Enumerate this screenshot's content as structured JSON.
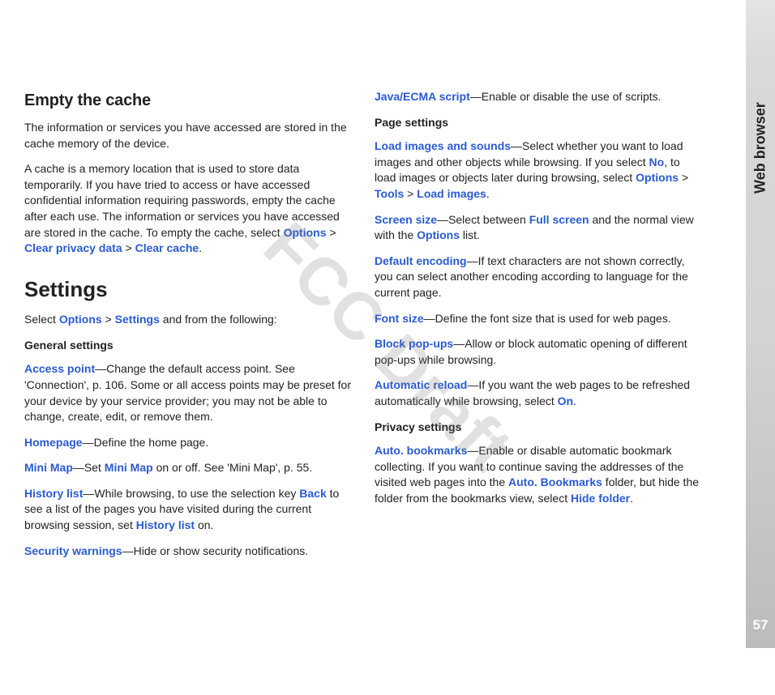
{
  "side": {
    "section": "Web browser",
    "pagenum": "57"
  },
  "watermark": "FCC Draft",
  "left": {
    "h_empty": "Empty the cache",
    "p1": "The information or services you have accessed are stored in the cache memory of the device.",
    "p2a": "A cache is a memory location that is used to store data temporarily. If you have tried to access or have accessed confidential information requiring passwords, empty the cache after each use. The information or services you have accessed are stored in the cache. To empty the cache, select ",
    "p2_opt": "Options",
    "p2_gt1": " > ",
    "p2_cpd": "Clear privacy data",
    "p2_gt2": " > ",
    "p2_cc": "Clear cache",
    "p2_end": ".",
    "h_settings": "Settings",
    "p3a": "Select ",
    "p3_opt": "Options",
    "p3_gt": " > ",
    "p3_set": "Settings",
    "p3b": " and from the following:",
    "sub_general": "General settings",
    "ap_t": "Access point",
    "ap_b": "—Change the default access point. See 'Connection', p. 106. Some or all access points may be preset for your device by your service provider; you may not be able to change, create, edit, or remove them.",
    "hp_t": "Homepage",
    "hp_b": "—Define the home page.",
    "mm_t": "Mini Map",
    "mm_b1": "—Set ",
    "mm_t2": "Mini Map",
    "mm_b2": " on or off. See 'Mini Map', p. 55.",
    "hl_t": "History list",
    "hl_b1": "—While browsing, to use the selection key ",
    "hl_back": "Back",
    "hl_b2": " to see a list of the pages you have visited during the current browsing session, set ",
    "hl_t2": "History list",
    "hl_b3": " on.",
    "sw_t": "Security warnings",
    "sw_b": "—Hide or show security notifications."
  },
  "right": {
    "js_t": "Java/ECMA script",
    "js_b": "—Enable or disable the use of scripts.",
    "sub_page": "Page settings",
    "li_t": "Load images and sounds",
    "li_b1": "—Select whether you want to load images and other objects while browsing. If you select ",
    "li_no": "No",
    "li_b2": ", to load images or objects later during browsing, select ",
    "li_opt": "Options",
    "li_gt1": " > ",
    "li_tools": "Tools",
    "li_gt2": " > ",
    "li_load": "Load images",
    "li_end": ".",
    "ss_t": "Screen size",
    "ss_b1": "—Select between ",
    "ss_full": "Full screen",
    "ss_b2": " and the normal view with the ",
    "ss_opt": "Options",
    "ss_b3": " list.",
    "de_t": "Default encoding",
    "de_b": "—If text characters are not shown correctly, you can select another encoding according to language for the current page.",
    "fs_t": "Font size",
    "fs_b": "—Define the font size that is used for web pages.",
    "bp_t": "Block pop-ups",
    "bp_b": "—Allow or block automatic opening of different pop-ups while browsing.",
    "ar_t": "Automatic reload",
    "ar_b1": "—If you want the web pages to be refreshed automatically while browsing, select ",
    "ar_on": "On",
    "ar_end": ".",
    "sub_priv": "Privacy settings",
    "ab_t": "Auto. bookmarks",
    "ab_b1": "—Enable or disable automatic bookmark collecting. If you want to continue saving the addresses of the visited web pages into the ",
    "ab_folder": "Auto. Bookmarks",
    "ab_b2": " folder, but hide the folder from the bookmarks view, select ",
    "ab_hide": "Hide folder",
    "ab_end": "."
  }
}
